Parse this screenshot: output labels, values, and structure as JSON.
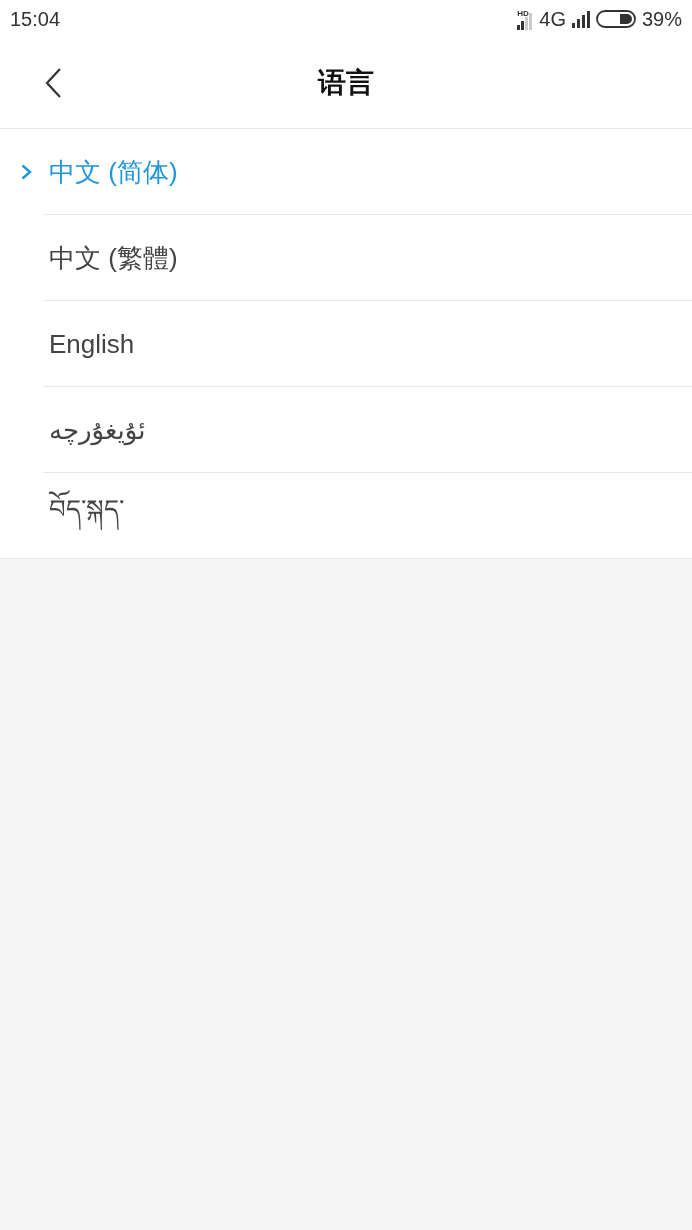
{
  "status_bar": {
    "time": "15:04",
    "hd_label": "HD",
    "network": "4G",
    "battery": "39%"
  },
  "header": {
    "title": "语言"
  },
  "languages": [
    {
      "label": "中文 (简体)",
      "selected": true
    },
    {
      "label": "中文 (繁體)",
      "selected": false
    },
    {
      "label": "English",
      "selected": false
    },
    {
      "label": "ئۇيغۇرچە",
      "selected": false
    },
    {
      "label": "བོད་སྐད་",
      "selected": false
    }
  ]
}
